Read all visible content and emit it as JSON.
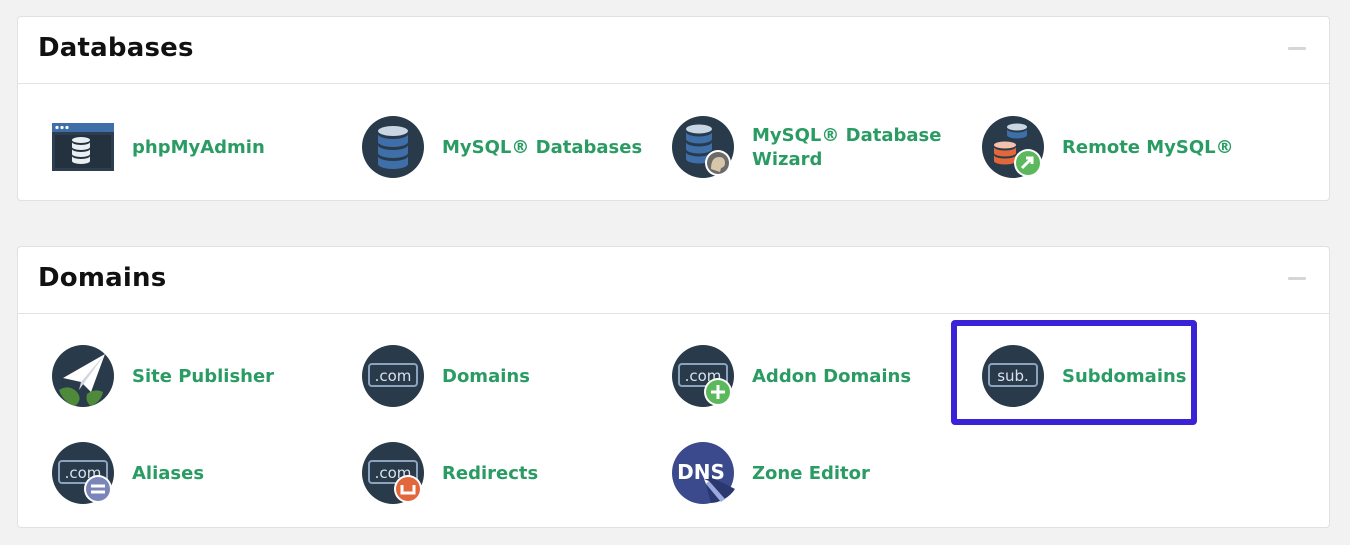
{
  "databases": {
    "title": "Databases",
    "items": [
      {
        "label": "phpMyAdmin",
        "icon": "phpmyadmin-icon"
      },
      {
        "label": "MySQL® Databases",
        "icon": "mysql-databases-icon"
      },
      {
        "label": "MySQL® Database Wizard",
        "icon": "mysql-wizard-icon"
      },
      {
        "label": "Remote MySQL®",
        "icon": "remote-mysql-icon"
      }
    ]
  },
  "domains": {
    "title": "Domains",
    "items": [
      {
        "label": "Site Publisher",
        "icon": "site-publisher-icon"
      },
      {
        "label": "Domains",
        "icon": "domains-icon"
      },
      {
        "label": "Addon Domains",
        "icon": "addon-domains-icon"
      },
      {
        "label": "Subdomains",
        "icon": "subdomains-icon",
        "highlighted": true
      },
      {
        "label": "Aliases",
        "icon": "aliases-icon"
      },
      {
        "label": "Redirects",
        "icon": "redirects-icon"
      },
      {
        "label": "Zone Editor",
        "icon": "zone-editor-icon"
      }
    ]
  },
  "icon_text": {
    "com": ".com",
    "sub": "sub.",
    "dns": "DNS"
  },
  "colors": {
    "label": "#2a9c63",
    "icon_dark": "#293a4a",
    "db_blue": "#3e6fa8",
    "highlight": "#3a22d6"
  }
}
